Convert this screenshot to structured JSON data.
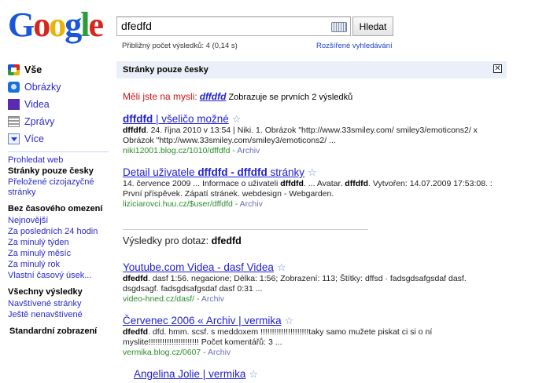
{
  "logo": [
    "G",
    "o",
    "o",
    "g",
    "l",
    "e"
  ],
  "search": {
    "query": "dfedfd",
    "button_label": "Hledat",
    "stats": "Přibližný počet výsledků: 4 (0,14 s)",
    "advanced_link": "Rozšířené vyhledávání"
  },
  "nav": {
    "types": [
      {
        "label": "Vše",
        "icon": "google-color-icon",
        "active": true
      },
      {
        "label": "Obrázky",
        "icon": "images-icon"
      },
      {
        "label": "Videa",
        "icon": "video-icon"
      },
      {
        "label": "Zprávy",
        "icon": "news-icon"
      },
      {
        "label": "Více",
        "icon": "dropdown-icon"
      }
    ],
    "language": {
      "all_web": "Prohledat web",
      "czech_only": "Stránky pouze česky",
      "translated": "Přeložené cizojazyčné stránky"
    },
    "time": {
      "heading": "Bez časového omezení",
      "items": [
        "Nejnovější",
        "Za posledních 24 hodin",
        "Za minulý týden",
        "Za minulý měsíc",
        "Za minulý rok",
        "Vlastní časový úsek..."
      ]
    },
    "results": {
      "heading": "Všechny výsledky",
      "items": [
        "Navštívené stránky",
        "Ještě nenavštívené"
      ]
    },
    "view": {
      "heading": "Standardní zobrazení"
    }
  },
  "language_bar": {
    "title": "Stránky pouze česky",
    "close": "✕"
  },
  "did_you_mean": {
    "label": "Měli jste na mysli:",
    "suggestion": "dffdfd",
    "note": "Zobrazuje se prvních 2 výsledků"
  },
  "results_czech": [
    {
      "title_bold": "dffdfd",
      "title_rest": " | všeličo možné",
      "snippet_html": "<b>dffdfd</b>. 24. října 2010 v 13:54 | Niki. 1. Obrázok \"http://www.33smiley.com/ smiley3/emoticons2/ x Obrázok \"http://www.33smiley.com/smiley3/emoticons2/ ...",
      "url": "niki12001.blog.cz/1010/dffdfd",
      "archive": "Archiv"
    },
    {
      "title_pre": "Detail uživatele ",
      "title_bold": "dffdfd - dffdfd",
      "title_rest": " stránky",
      "snippet_html": "14. července 2009 ... Informace o uživateli <b>dffdfd</b>. ... Avatar. <b>dffdfd</b>. Vytvořen: 14.07.2009 17:53:08. : První příspěvek. Zápatí stránek. webdesign - Webgarden.",
      "url": "liziciarovci.huu.cz/$user/dffdfd",
      "archive": "Archiv"
    }
  ],
  "results_for": {
    "label": "Výsledky pro dotaz:",
    "query": "dfedfd"
  },
  "results_main": [
    {
      "title": "Youtube.com Videa - dasf Videa",
      "snippet_html": "<b>dfedfd</b>. dasf 1:56. negacione; Délka: 1:56; Zobrazení: 113; Štítky: dffsd · fadsgdsafgsdaf dasf. dsgdsagf. fadsgdsafgsdaf dasf 0:31 ...",
      "url": "video-hned.cz/dasf/",
      "archive": "Archiv"
    },
    {
      "title": "Červenec 2006 « Archiv | vermika",
      "snippet_html": "<b>dfedfd</b>. dfd. hmm. scsf. s meddoxem !!!!!!!!!!!!!!!!!!!!!taky samo mužete piskat ci si o ní myslite!!!!!!!!!!!!!!!!!!!!!! Počet komentářů: 3 ...",
      "url": "vermika.blog.cz/0607",
      "archive": "Archiv"
    },
    {
      "title": "Angelina Jolie | vermika"
    }
  ]
}
